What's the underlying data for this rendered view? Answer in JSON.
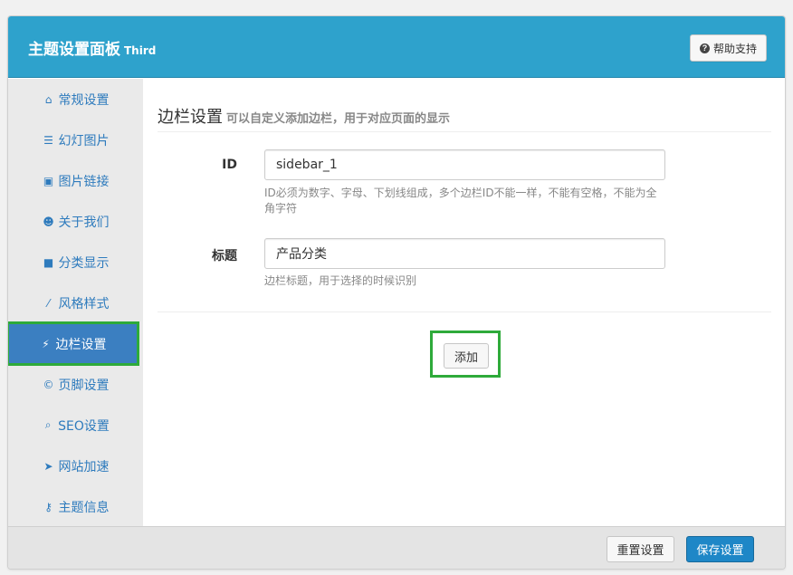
{
  "header": {
    "title": "主题设置面板",
    "subtitle": "Third",
    "help_label": "帮助支持"
  },
  "sidebar": {
    "items": [
      {
        "label": "常规设置",
        "icon": "home-icon"
      },
      {
        "label": "幻灯图片",
        "icon": "sliders-icon"
      },
      {
        "label": "图片链接",
        "icon": "image-icon"
      },
      {
        "label": "关于我们",
        "icon": "users-icon"
      },
      {
        "label": "分类显示",
        "icon": "folder-icon"
      },
      {
        "label": "风格样式",
        "icon": "magic-wand-icon"
      },
      {
        "label": "边栏设置",
        "icon": "plug-icon",
        "active": true
      },
      {
        "label": "页脚设置",
        "icon": "copyright-icon"
      },
      {
        "label": "SEO设置",
        "icon": "search-icon"
      },
      {
        "label": "网站加速",
        "icon": "rocket-icon"
      },
      {
        "label": "主题信息",
        "icon": "key-icon"
      }
    ]
  },
  "section": {
    "title": "边栏设置",
    "description": "可以自定义添加边栏，用于对应页面的显示"
  },
  "form": {
    "id_label": "ID",
    "id_value": "sidebar_1",
    "id_hint": "ID必须为数字、字母、下划线组成，多个边栏ID不能一样，不能有空格，不能为全角字符",
    "title_label": "标题",
    "title_value": "产品分类",
    "title_hint": "边栏标题，用于选择的时候识别",
    "add_label": "添加"
  },
  "footer": {
    "reset_label": "重置设置",
    "save_label": "保存设置"
  },
  "colors": {
    "header_bg": "#2ea2cc",
    "active_nav": "#3b7fc1",
    "highlight": "#2eaa3a",
    "save_btn": "#1e87c7"
  }
}
